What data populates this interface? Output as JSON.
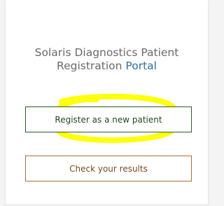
{
  "portal": {
    "title_line1": "Solaris Diagnostics Patient",
    "title_line2_plain": "Registration ",
    "title_line2_accent": "Portal"
  },
  "buttons": {
    "register_label": "Register as a new patient",
    "results_label": "Check your results"
  },
  "colors": {
    "accent": "#2e6fa7",
    "highlight": "#ffff00",
    "register_border": "#2e5a2a",
    "results_border": "#a5703a"
  }
}
